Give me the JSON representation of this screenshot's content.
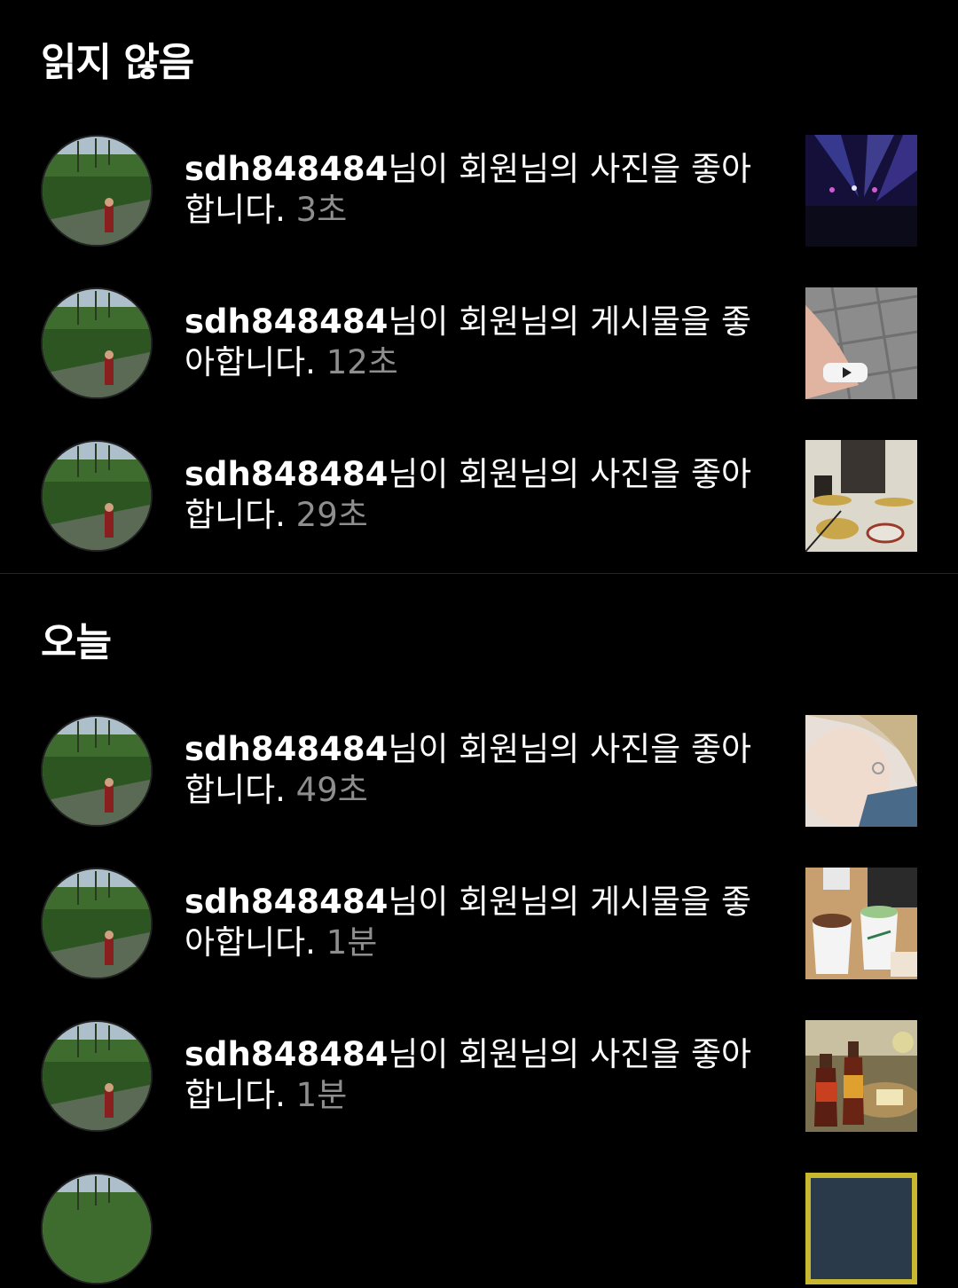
{
  "sections": {
    "unread_title": "읽지 않음",
    "today_title": "오늘"
  },
  "notifications": [
    {
      "username": "sdh848484",
      "message": "님이 회원님의 사진을 좋아합니다.",
      "time": "3초",
      "thumbnail": "concert-stage-photo"
    },
    {
      "username": "sdh848484",
      "message": "님이 회원님의 게시물을 좋아합니다.",
      "time": "12초",
      "thumbnail": "wrist-band-photo"
    },
    {
      "username": "sdh848484",
      "message": "님이 회원님의 사진을 좋아합니다.",
      "time": "29초",
      "thumbnail": "drum-kit-photo"
    },
    {
      "username": "sdh848484",
      "message": "님이 회원님의 사진을 좋아합니다.",
      "time": "49초",
      "thumbnail": "selfie-photo"
    },
    {
      "username": "sdh848484",
      "message": "님이 회원님의 게시물을 좋아합니다.",
      "time": "1분",
      "thumbnail": "coffee-cups-photo"
    },
    {
      "username": "sdh848484",
      "message": "님이 회원님의 사진을 좋아합니다.",
      "time": "1분",
      "thumbnail": "beer-bottles-photo"
    }
  ],
  "colors": {
    "background": "#000000",
    "text": "#ffffff",
    "timestamp": "#8e8e8e"
  }
}
